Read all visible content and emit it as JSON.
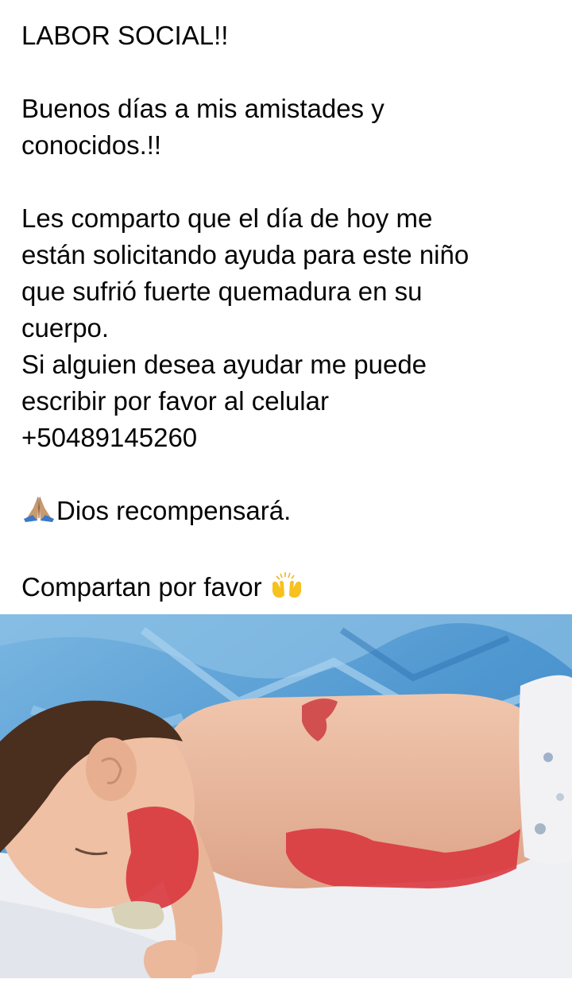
{
  "post": {
    "title": "LABOR SOCIAL!!",
    "greeting": [
      "Buenos días a mis amistades y",
      "conocidos.!!"
    ],
    "body": [
      "Les comparto que el día de hoy me",
      "están solicitando ayuda para este niño",
      "que sufrió fuerte quemadura en su",
      "cuerpo.",
      "Si alguien desea ayudar me puede",
      "escribir por favor al celular",
      "+50489145260"
    ],
    "blessing": "Dios recompensará.",
    "blessing_emoji": "praying-hands-icon",
    "share_text": "Compartan por favor",
    "share_emoji": "raising-hands-icon"
  },
  "photo": {
    "subject": "infant-with-burn-injuries",
    "colors": {
      "sheet": "#5aa4d8",
      "skin": "#eab79a",
      "burn": "#d9393f",
      "diaper": "#f2f2f4",
      "hair": "#4a2f1f"
    }
  }
}
